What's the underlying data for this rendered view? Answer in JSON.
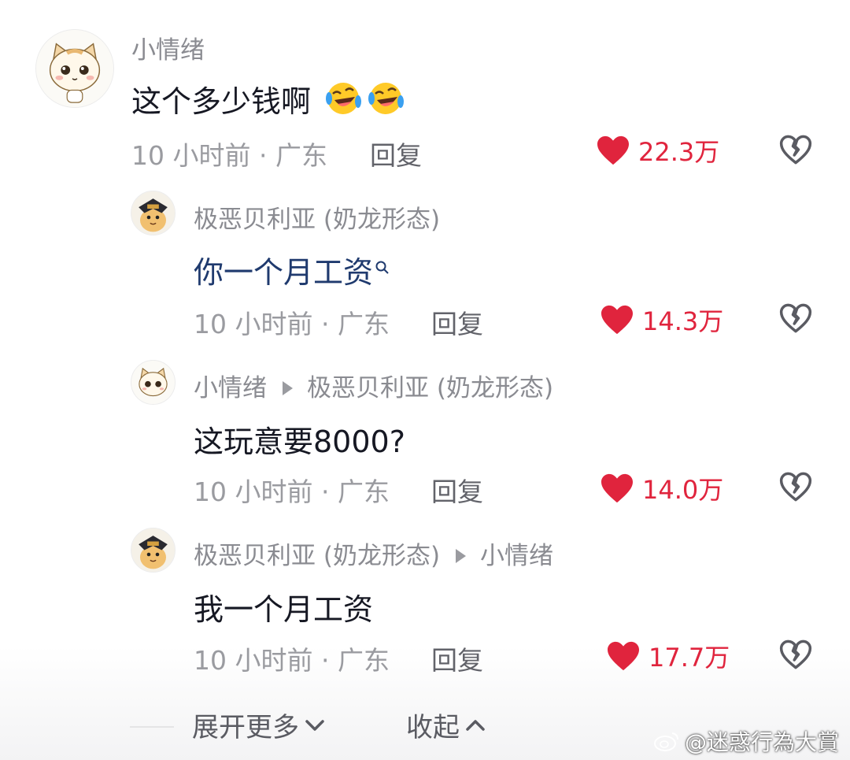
{
  "comments": [
    {
      "username": "小情绪",
      "reply_to": "",
      "text": "这个多少钱啊",
      "emojis": [
        "rofl-emoji",
        "rofl-emoji"
      ],
      "time": "10 小时前",
      "location": "广东",
      "reply_label": "回复",
      "likes": "22.3万"
    },
    {
      "username": "极恶贝利亚 (奶龙形态)",
      "reply_to": "",
      "text": "你一个月工资",
      "time": "10 小时前",
      "location": "广东",
      "reply_label": "回复",
      "likes": "14.3万"
    },
    {
      "username": "小情绪",
      "reply_to": "极恶贝利亚 (奶龙形态)",
      "text": "这玩意要8000?",
      "time": "10 小时前",
      "location": "广东",
      "reply_label": "回复",
      "likes": "14.0万"
    },
    {
      "username": "极恶贝利亚 (奶龙形态)",
      "reply_to": "小情绪",
      "text": "我一个月工资",
      "time": "10 小时前",
      "location": "广东",
      "reply_label": "回复",
      "likes": "17.7万"
    }
  ],
  "footer": {
    "expand_label": "展开更多",
    "collapse_label": "收起"
  },
  "watermark": "@迷惑行為大賞",
  "colors": {
    "like": "#e0243d",
    "highlight_text": "#1f3a6e",
    "meta_text": "#9a9ba0",
    "username": "#8a8b91"
  },
  "icons": {
    "like": "heart-icon",
    "dislike": "broken-heart-icon",
    "search": "search-icon",
    "expand": "chevron-down-icon",
    "collapse": "chevron-up-icon",
    "reply_arrow": "triangle-right-icon"
  }
}
